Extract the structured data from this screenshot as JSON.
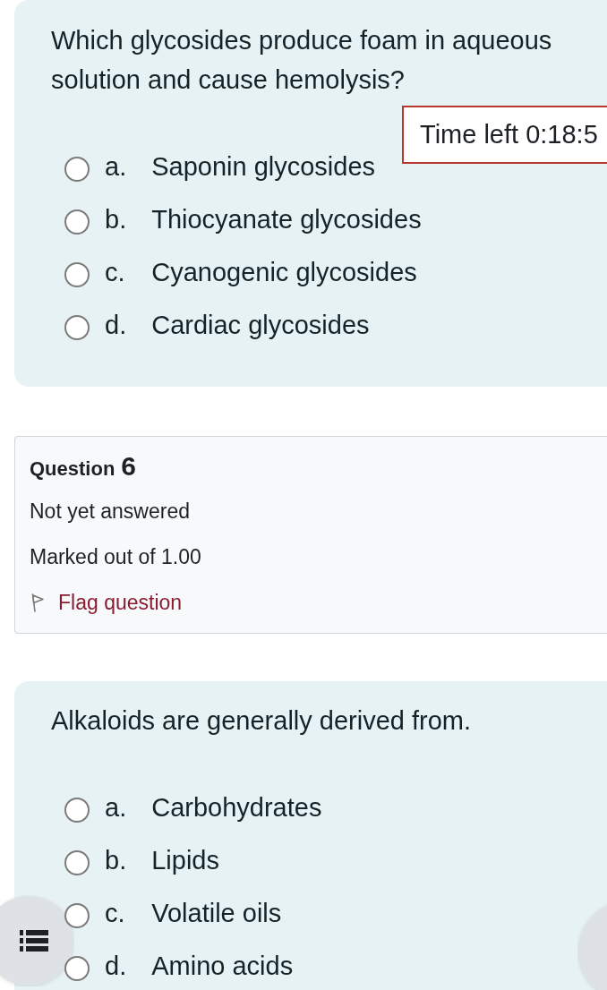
{
  "timer": {
    "text": "Time left 0:18:5"
  },
  "blocks": [
    {
      "kind": "question",
      "text": "Which glycosides produce foam in aqueous solution and cause hemolysis?",
      "options": [
        {
          "letter": "a.",
          "text": "Saponin glycosides",
          "selected": false
        },
        {
          "letter": "b.",
          "text": "Thiocyanate glycosides",
          "selected": false
        },
        {
          "letter": "c.",
          "text": "Cyanogenic glycosides",
          "selected": false
        },
        {
          "letter": "d.",
          "text": "Cardiac glycosides",
          "selected": false
        }
      ]
    },
    {
      "kind": "info",
      "label": "Question",
      "number": "6",
      "status": "Not yet answered",
      "marks": "Marked out of 1.00",
      "flag": {
        "label": "Flag question",
        "flagged": false
      }
    },
    {
      "kind": "question",
      "text": "Alkaloids are generally derived from.",
      "options": [
        {
          "letter": "a.",
          "text": "Carbohydrates",
          "selected": false
        },
        {
          "letter": "b.",
          "text": "Lipids",
          "selected": false
        },
        {
          "letter": "c.",
          "text": "Volatile oils",
          "selected": false
        },
        {
          "letter": "d.",
          "text": "Amino acids",
          "selected": false
        }
      ]
    }
  ]
}
